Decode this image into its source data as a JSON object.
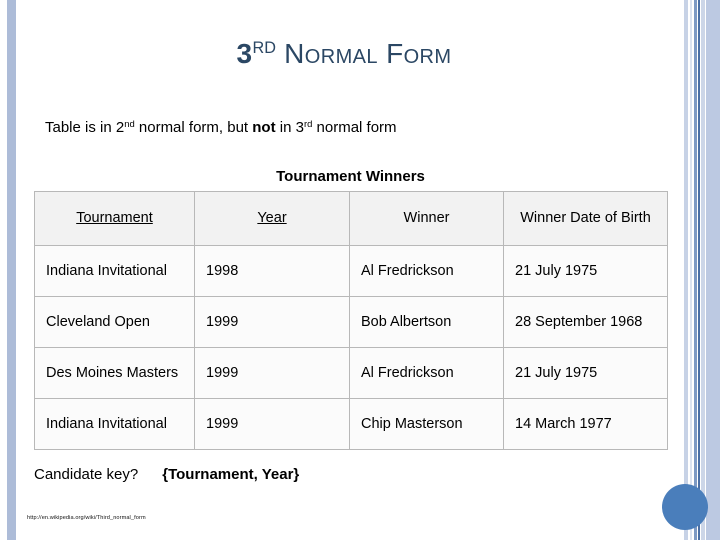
{
  "slide": {
    "title": {
      "main_number": "3",
      "ordinal_suffix": "RD",
      "rest": "Normal Form",
      "color": "#2b4764"
    },
    "subtitle": {
      "part1": "Table is in 2",
      "sup1": "nd",
      "part2": " normal form, but ",
      "emphasis": "not",
      "part3": " in 3",
      "sup2": "rd",
      "part4": " normal form"
    },
    "table_caption": "Tournament Winners",
    "table": {
      "columns": [
        {
          "label": "Tournament",
          "is_key": true
        },
        {
          "label": "Year",
          "is_key": true
        },
        {
          "label": "Winner",
          "is_key": false
        },
        {
          "label": "Winner Date of Birth",
          "is_key": false
        }
      ],
      "rows": [
        {
          "tournament": "Indiana Invitational",
          "year": "1998",
          "winner": "Al Fredrickson",
          "dob": "21 July 1975"
        },
        {
          "tournament": "Cleveland Open",
          "year": "1999",
          "winner": "Bob Albertson",
          "dob": "28 September 1968"
        },
        {
          "tournament": "Des Moines Masters",
          "year": "1999",
          "winner": "Al Fredrickson",
          "dob": "21 July 1975"
        },
        {
          "tournament": "Indiana Invitational",
          "year": "1999",
          "winner": "Chip Masterson",
          "dob": "14 March 1977"
        }
      ]
    },
    "candidate_key": {
      "label": "Candidate key?",
      "value": "{Tournament, Year}"
    },
    "source_url": "http://en.wikipedia.org/wiki/Third_normal_form",
    "decor": {
      "left_bar_color": "#adbcd8",
      "stripe_colors": [
        "#c7d2e6",
        "#dbe3f0",
        "#7d9ac4",
        "#4a6fa5",
        "#ccd6e8",
        "#bcc9e2"
      ],
      "circle_color": "#4a7ebb"
    }
  }
}
